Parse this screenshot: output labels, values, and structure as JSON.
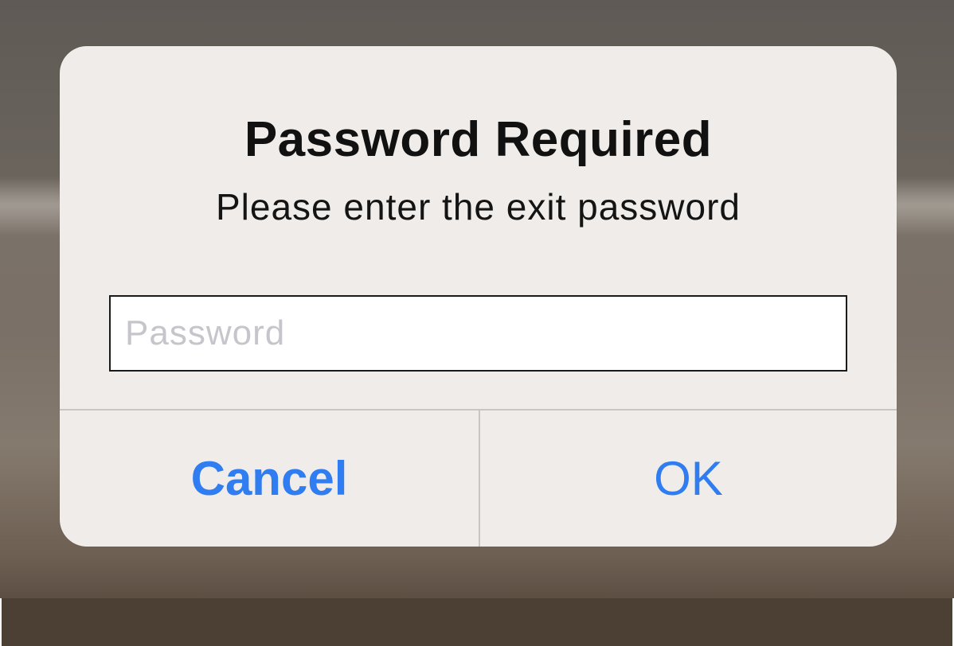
{
  "dialog": {
    "title": "Password Required",
    "message": "Please enter the exit password",
    "password_field": {
      "value": "",
      "placeholder": "Password"
    },
    "buttons": {
      "cancel_label": "Cancel",
      "ok_label": "OK"
    }
  },
  "colors": {
    "accent": "#2f7df0",
    "dialog_background": "#f0ece9",
    "title_text": "#111111",
    "placeholder_text": "#c5c5cb",
    "divider": "#c9c5c2",
    "bottom_bar": "#4c3f33"
  }
}
